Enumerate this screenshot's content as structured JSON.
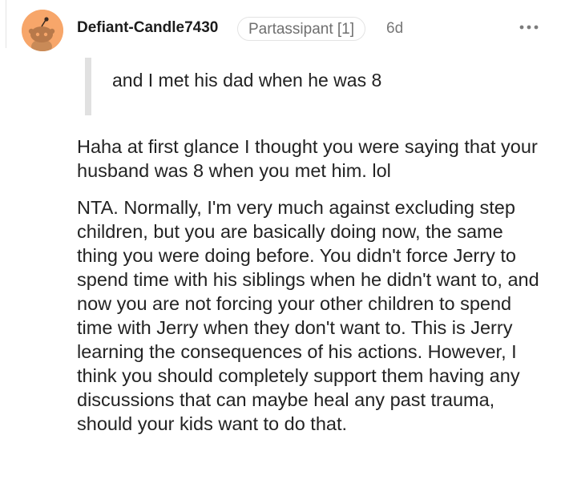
{
  "comment": {
    "author": "Defiant-Candle7430",
    "flair": "Partassipant [1]",
    "timestamp": "6d",
    "more_icon": "more-horizontal-icon",
    "avatar_icon": "snoo-avatar-icon",
    "avatar_color": "#f7a66a",
    "quote": "and I met his dad when he was 8",
    "paragraphs": [
      "Haha at first glance I thought you were saying that your husband was 8 when you met him. lol",
      "NTA. Normally, I'm very much against excluding step children, but you are basically doing now, the same thing you were doing before. You didn't force Jerry to spend time with his siblings when he didn't want to, and now you are not forcing your other children to spend time with Jerry when they don't want to. This is Jerry learning the consequences of his actions. However, I think you should completely support them having any discussions that can maybe heal any past trauma, should your kids want to do that."
    ]
  }
}
